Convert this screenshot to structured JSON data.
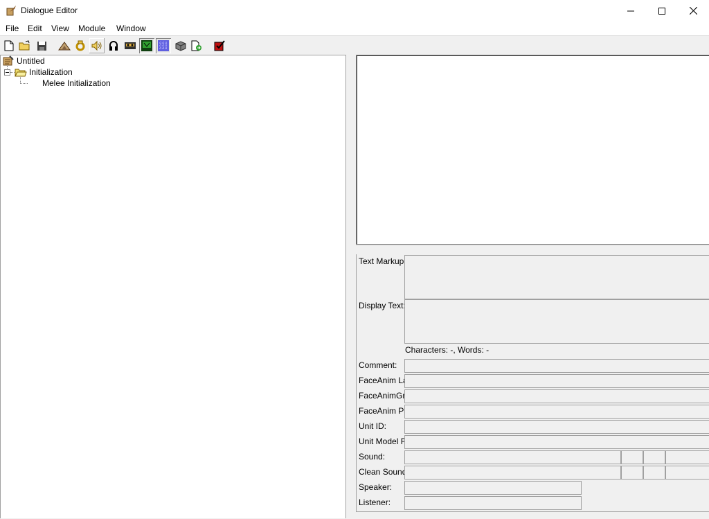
{
  "window": {
    "title": "Dialogue Editor"
  },
  "menu": [
    "File",
    "Edit",
    "View",
    "Module",
    "Window"
  ],
  "toolbar": [
    "new-file-icon",
    "open-folder-icon",
    "save-disk-icon",
    "terrain-icon",
    "ring-icon",
    "sound-speaker-icon",
    "headphones-icon",
    "tape-icon",
    "monitor-icon",
    "noise-icon",
    "package-icon",
    "export-icon",
    "checkbox-icon"
  ],
  "tree": {
    "root": "Untitled",
    "folder": "Initialization",
    "child": "Melee Initialization"
  },
  "props": {
    "text_markup": "Text Markup:",
    "display_text": "Display Text:",
    "counts": "Characters: -, Words: -",
    "comment": "Comment:",
    "faceanim_label": "FaceAnim Label:",
    "faceanim_group": "FaceAnimGroup:",
    "faceanim_path": "FaceAnim Path:",
    "unit_id": "Unit ID:",
    "unit_model_file": "Unit Model File:",
    "sound": "Sound:",
    "clean_sound": "Clean Sound:",
    "speaker": "Speaker:",
    "listener": "Listener:"
  }
}
